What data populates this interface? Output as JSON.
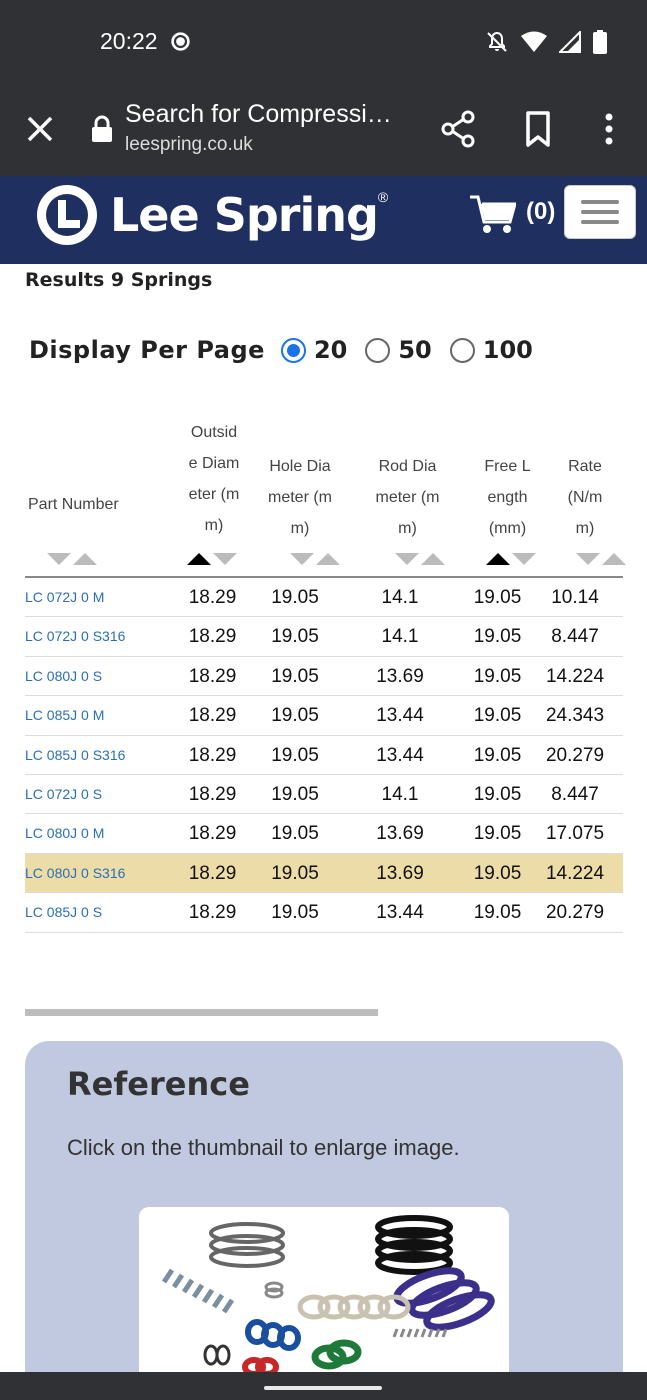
{
  "status_bar": {
    "time": "20:22",
    "icons": [
      "data-saver-icon",
      "notifications-off-icon",
      "wifi-icon",
      "signal-icon",
      "battery-icon"
    ]
  },
  "browser": {
    "title": "Search for Compressi…",
    "url": "leespring.co.uk",
    "icons": [
      "close-icon",
      "lock-icon",
      "share-icon",
      "bookmark-icon",
      "more-vert-icon"
    ]
  },
  "site": {
    "logo_text": "Lee Spring",
    "logo_reg": "®",
    "cart_count": "(0)",
    "header_color": "#1f2f5f"
  },
  "results": {
    "label": "Results 9 Springs"
  },
  "per_page": {
    "label": "Display Per Page",
    "options": [
      {
        "value": "20",
        "selected": true
      },
      {
        "value": "50",
        "selected": false
      },
      {
        "value": "100",
        "selected": false
      }
    ]
  },
  "table": {
    "headers": [
      {
        "lines": [
          "Part Number"
        ],
        "sort": "none"
      },
      {
        "lines": [
          "Outsid",
          "e Diam",
          "eter (m",
          "m)"
        ],
        "sort": "asc"
      },
      {
        "lines": [
          "Hole Dia",
          "meter (m",
          "m)"
        ],
        "sort": "none"
      },
      {
        "lines": [
          "Rod Dia",
          "meter (m",
          "m)"
        ],
        "sort": "none"
      },
      {
        "lines": [
          "Free L",
          "ength",
          "(mm)"
        ],
        "sort": "asc"
      },
      {
        "lines": [
          "Rate",
          "(N/m",
          "m)"
        ],
        "sort": "none"
      }
    ],
    "rows": [
      {
        "part": "LC 072J 0 M",
        "od": "18.29",
        "hole": "19.05",
        "rod": "14.1",
        "free": "19.05",
        "rate": "10.14",
        "highlight": false
      },
      {
        "part": "LC 072J 0 S316",
        "od": "18.29",
        "hole": "19.05",
        "rod": "14.1",
        "free": "19.05",
        "rate": "8.447",
        "highlight": false
      },
      {
        "part": "LC 080J 0 S",
        "od": "18.29",
        "hole": "19.05",
        "rod": "13.69",
        "free": "19.05",
        "rate": "14.224",
        "highlight": false
      },
      {
        "part": "LC 085J 0 M",
        "od": "18.29",
        "hole": "19.05",
        "rod": "13.44",
        "free": "19.05",
        "rate": "24.343",
        "highlight": false
      },
      {
        "part": "LC 085J 0 S316",
        "od": "18.29",
        "hole": "19.05",
        "rod": "13.44",
        "free": "19.05",
        "rate": "20.279",
        "highlight": false
      },
      {
        "part": "LC 072J 0 S",
        "od": "18.29",
        "hole": "19.05",
        "rod": "14.1",
        "free": "19.05",
        "rate": "8.447",
        "highlight": false
      },
      {
        "part": "LC 080J 0 M",
        "od": "18.29",
        "hole": "19.05",
        "rod": "13.69",
        "free": "19.05",
        "rate": "17.075",
        "highlight": false
      },
      {
        "part": "LC 080J 0 S316",
        "od": "18.29",
        "hole": "19.05",
        "rod": "13.69",
        "free": "19.05",
        "rate": "14.224",
        "highlight": true
      },
      {
        "part": "LC 085J 0 S",
        "od": "18.29",
        "hole": "19.05",
        "rod": "13.44",
        "free": "19.05",
        "rate": "20.279",
        "highlight": false
      }
    ]
  },
  "reference": {
    "title": "Reference",
    "text": "Click on the thumbnail to enlarge image."
  }
}
